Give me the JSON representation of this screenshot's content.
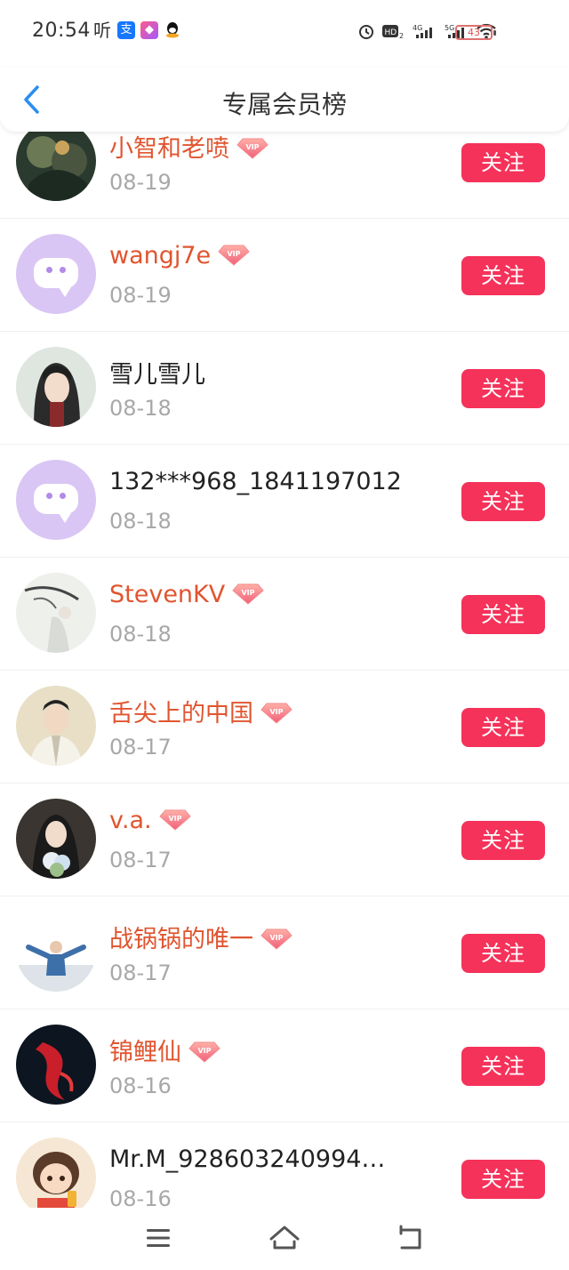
{
  "status_bar": {
    "time": "20:54",
    "ting_glyph": "听",
    "battery_text": "43",
    "network_labels": [
      "HD2",
      "4G",
      "5G"
    ]
  },
  "header": {
    "title": "专属会员榜",
    "back_icon": "chevron-left-icon"
  },
  "colors": {
    "accent": "#f5325a",
    "vip_name": "#e0552f",
    "back_arrow": "#2b8ef0",
    "date_gray": "#a8a8a8"
  },
  "members": [
    {
      "name": "小智和老喷",
      "date": "08-19",
      "vip": true,
      "avatar": "game-art",
      "follow_label": "关注"
    },
    {
      "name": "wangj7e",
      "date": "08-19",
      "vip": true,
      "avatar": "default",
      "follow_label": "关注"
    },
    {
      "name": "雪儿雪儿",
      "date": "08-18",
      "vip": false,
      "avatar": "anime-girl",
      "follow_label": "关注"
    },
    {
      "name": "132***968_1841197012",
      "date": "08-18",
      "vip": false,
      "avatar": "default",
      "follow_label": "关注"
    },
    {
      "name": "StevenKV",
      "date": "08-18",
      "vip": true,
      "avatar": "ink-painting",
      "follow_label": "关注"
    },
    {
      "name": "舌尖上的中国",
      "date": "08-17",
      "vip": true,
      "avatar": "costume-man",
      "follow_label": "关注"
    },
    {
      "name": "v.a.",
      "date": "08-17",
      "vip": true,
      "avatar": "girl-flowers",
      "follow_label": "关注"
    },
    {
      "name": "战锅锅的唯一",
      "date": "08-17",
      "vip": true,
      "avatar": "jumping-man",
      "follow_label": "关注"
    },
    {
      "name": "锦鲤仙",
      "date": "08-16",
      "vip": true,
      "avatar": "red-koi",
      "follow_label": "关注"
    },
    {
      "name": "Mr.M_928603240994…",
      "date": "08-16",
      "vip": false,
      "avatar": "cartoon-girl",
      "follow_label": "关注"
    }
  ],
  "vip_badge_text": "VIP",
  "nav": [
    "menu-icon",
    "home-icon",
    "back-icon"
  ]
}
